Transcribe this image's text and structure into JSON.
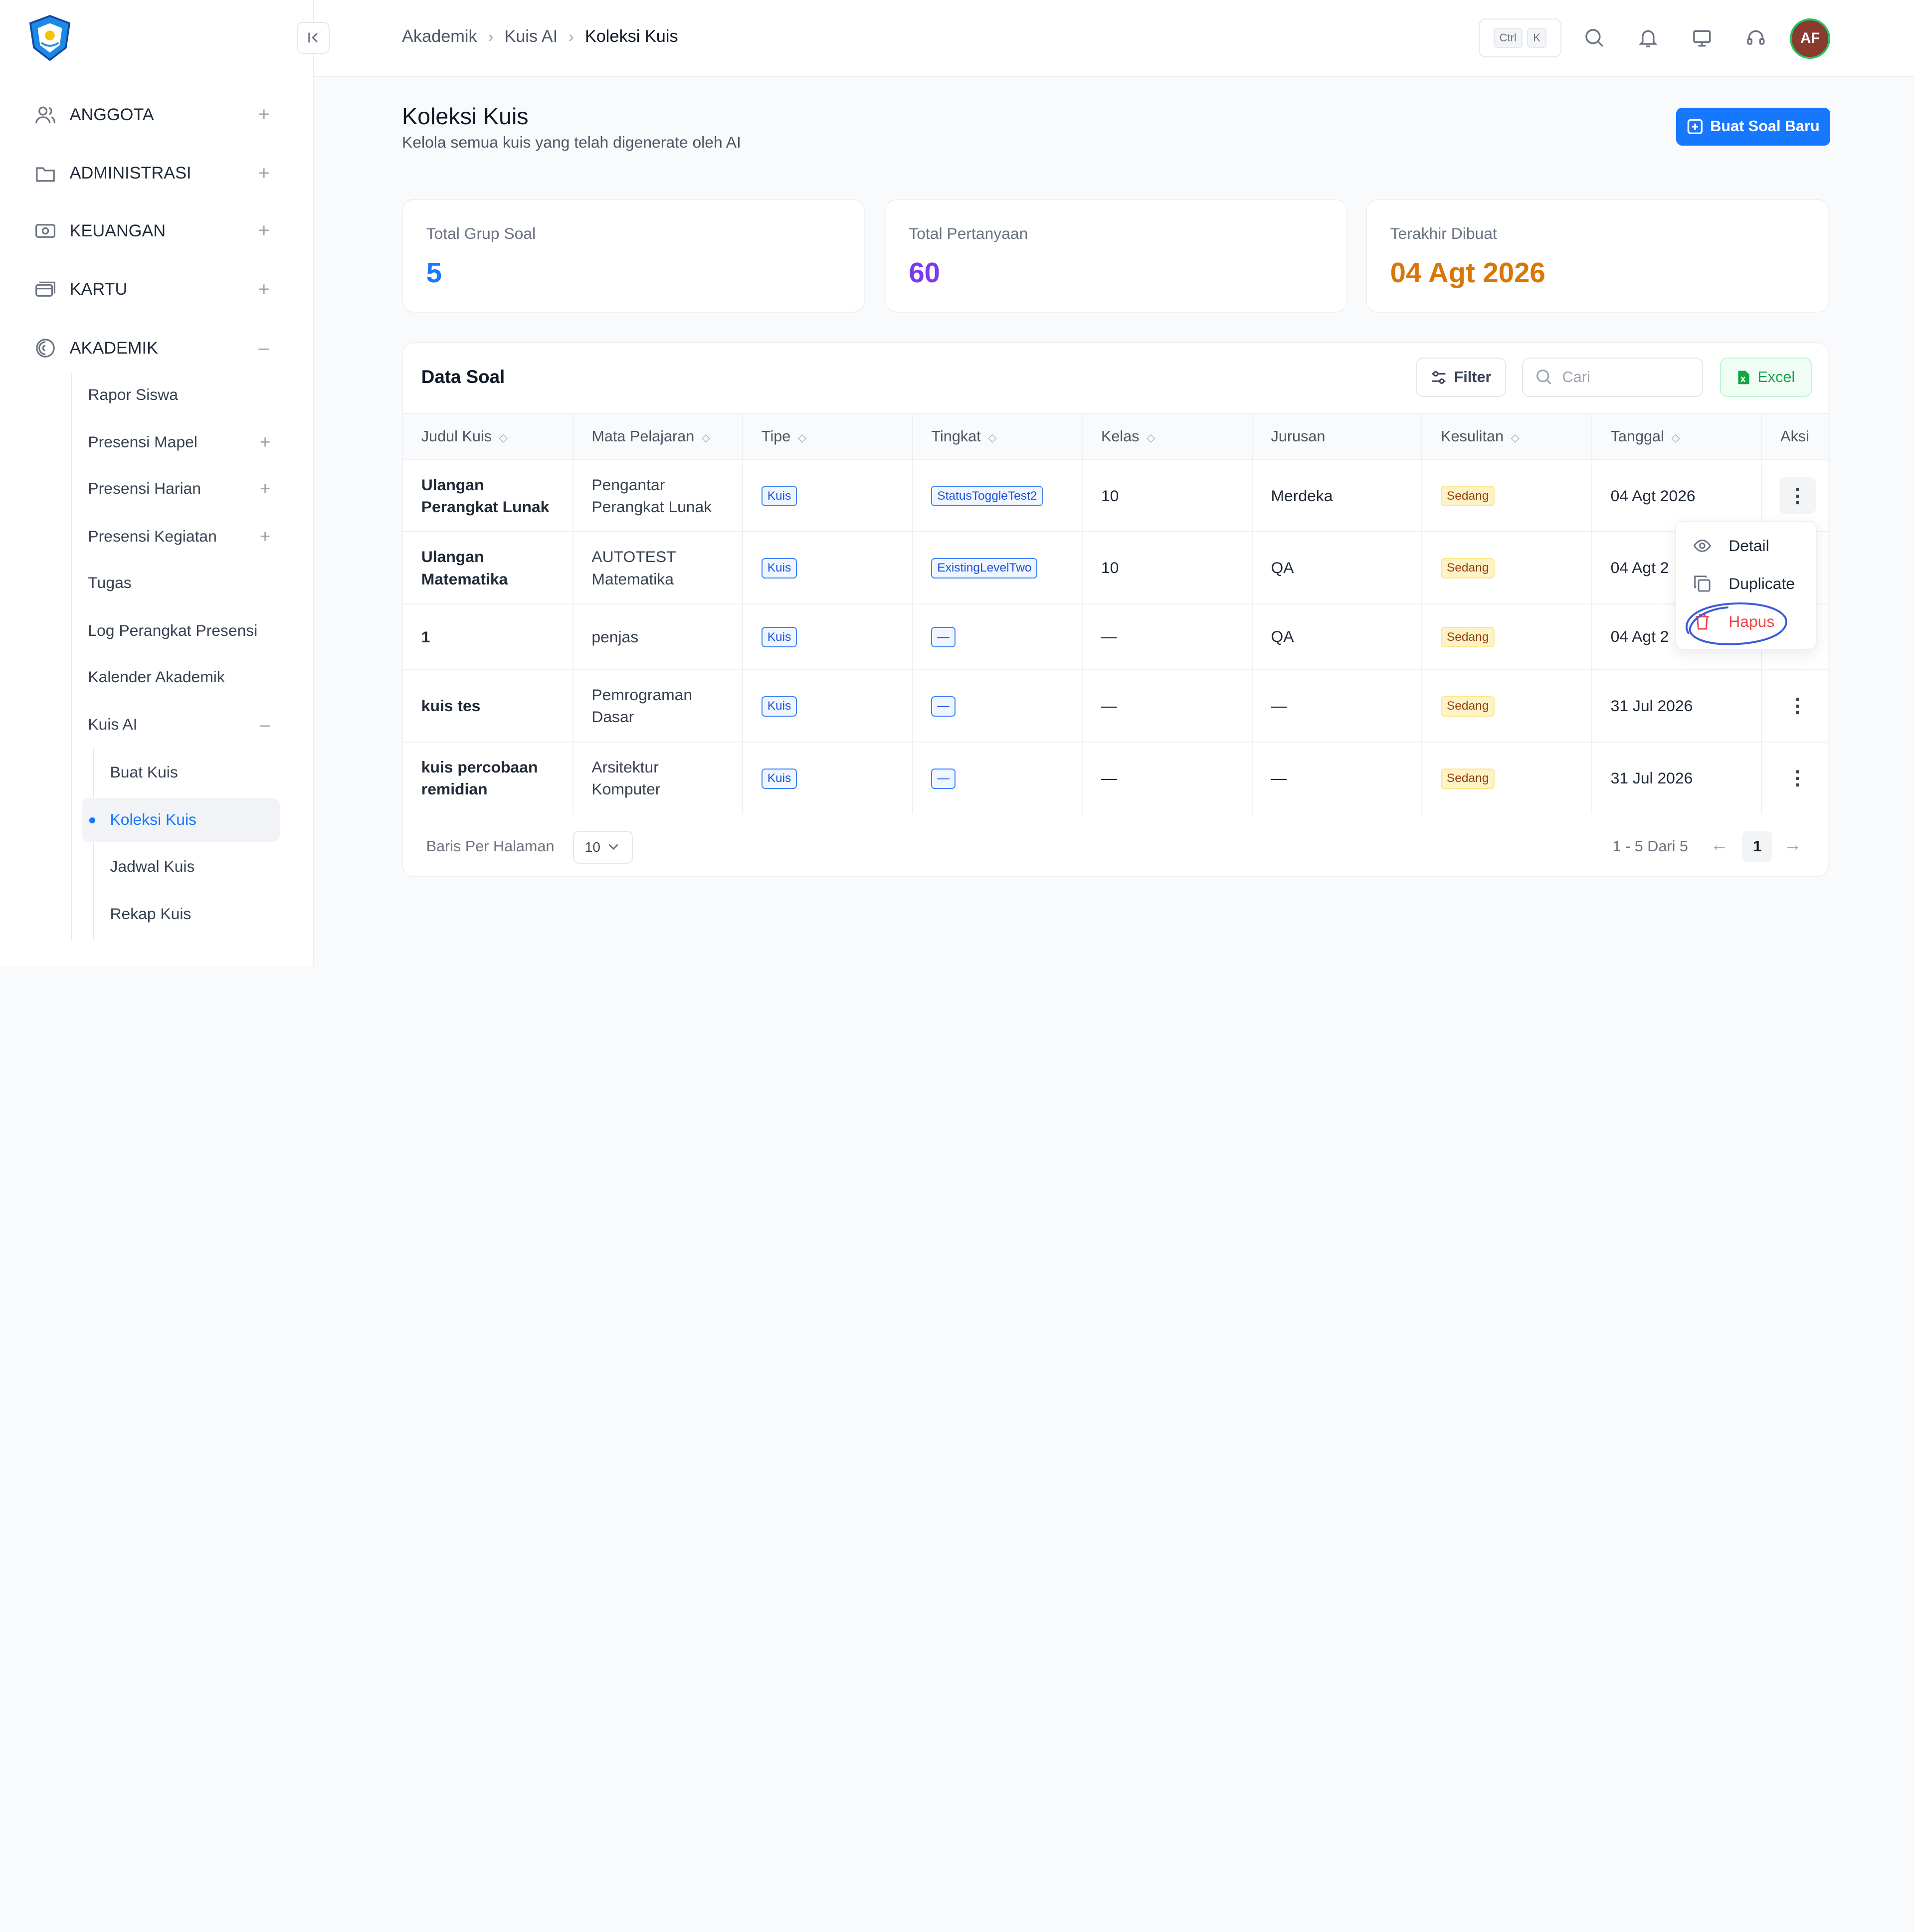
{
  "sidebar": {
    "sections": [
      {
        "label": "ANGGOTA",
        "icon": "users-icon"
      },
      {
        "label": "ADMINISTRASI",
        "icon": "folder-icon"
      },
      {
        "label": "KEUANGAN",
        "icon": "money-icon"
      },
      {
        "label": "KARTU",
        "icon": "card-icon"
      },
      {
        "label": "AKADEMIK",
        "icon": "academic-icon"
      }
    ],
    "akademik_items": [
      "Rapor Siswa",
      "Presensi Mapel",
      "Presensi Harian",
      "Presensi Kegiatan",
      "Tugas",
      "Log Perangkat Presensi",
      "Kalender Akademik",
      "Kuis AI"
    ],
    "kuis_items": [
      "Buat Kuis",
      "Koleksi Kuis",
      "Jadwal Kuis",
      "Rekap Kuis"
    ]
  },
  "topbar": {
    "breadcrumb": [
      "Akademik",
      "Kuis AI",
      "Koleksi Kuis"
    ],
    "kbd": [
      "Ctrl",
      "K"
    ],
    "avatar": "AF"
  },
  "header": {
    "title": "Koleksi Kuis",
    "subtitle": "Kelola semua kuis yang telah digenerate oleh AI",
    "new_button": "Buat Soal Baru"
  },
  "stats": [
    {
      "label": "Total Grup Soal",
      "value": "5",
      "color": "#1677ff"
    },
    {
      "label": "Total Pertanyaan",
      "value": "60",
      "color": "#7c3aed"
    },
    {
      "label": "Terakhir Dibuat",
      "value": "04 Agt 2026",
      "color": "#d97706"
    }
  ],
  "table": {
    "title": "Data Soal",
    "filter_label": "Filter",
    "search_placeholder": "Cari",
    "excel_label": "Excel",
    "columns": [
      "Judul Kuis",
      "Mata Pelajaran",
      "Tipe",
      "Tingkat",
      "Kelas",
      "Jurusan",
      "Kesulitan",
      "Tanggal",
      "Aksi"
    ],
    "rows": [
      {
        "title": [
          "Ulangan",
          "Perangkat Lunak"
        ],
        "subject": [
          "Pengantar",
          "Perangkat Lunak"
        ],
        "type": "Kuis",
        "level": "StatusToggleTest2",
        "kelas": "10",
        "jurusan": "Merdeka",
        "difficulty": "Sedang",
        "date": "04 Agt 2026"
      },
      {
        "title": [
          "Ulangan",
          "Matematika"
        ],
        "subject": [
          "AUTOTEST",
          "Matematika"
        ],
        "type": "Kuis",
        "level": "ExistingLevelTwo",
        "kelas": "10",
        "jurusan": "QA",
        "difficulty": "Sedang",
        "date": "04 Agt 2"
      },
      {
        "title": [
          "1"
        ],
        "subject": [
          "penjas"
        ],
        "type": "Kuis",
        "level": "—",
        "kelas": "—",
        "jurusan": "QA",
        "difficulty": "Sedang",
        "date": "04 Agt 2"
      },
      {
        "title": [
          "kuis tes"
        ],
        "subject": [
          "Pemrograman",
          "Dasar"
        ],
        "type": "Kuis",
        "level": "—",
        "kelas": "—",
        "jurusan": "—",
        "difficulty": "Sedang",
        "date": "31 Jul 2026"
      },
      {
        "title": [
          "kuis percobaan",
          "remidian"
        ],
        "subject": [
          "Arsitektur",
          "Komputer"
        ],
        "type": "Kuis",
        "level": "—",
        "kelas": "—",
        "jurusan": "—",
        "difficulty": "Sedang",
        "date": "31 Jul 2026"
      }
    ]
  },
  "pager": {
    "rows_label": "Baris Per Halaman",
    "rows_value": "10",
    "info": "1 - 5 Dari 5",
    "page": "1"
  },
  "menu": {
    "items": [
      {
        "label": "Detail",
        "icon": "eye-icon"
      },
      {
        "label": "Duplicate",
        "icon": "copy-icon"
      },
      {
        "label": "Hapus",
        "icon": "trash-icon"
      }
    ]
  }
}
